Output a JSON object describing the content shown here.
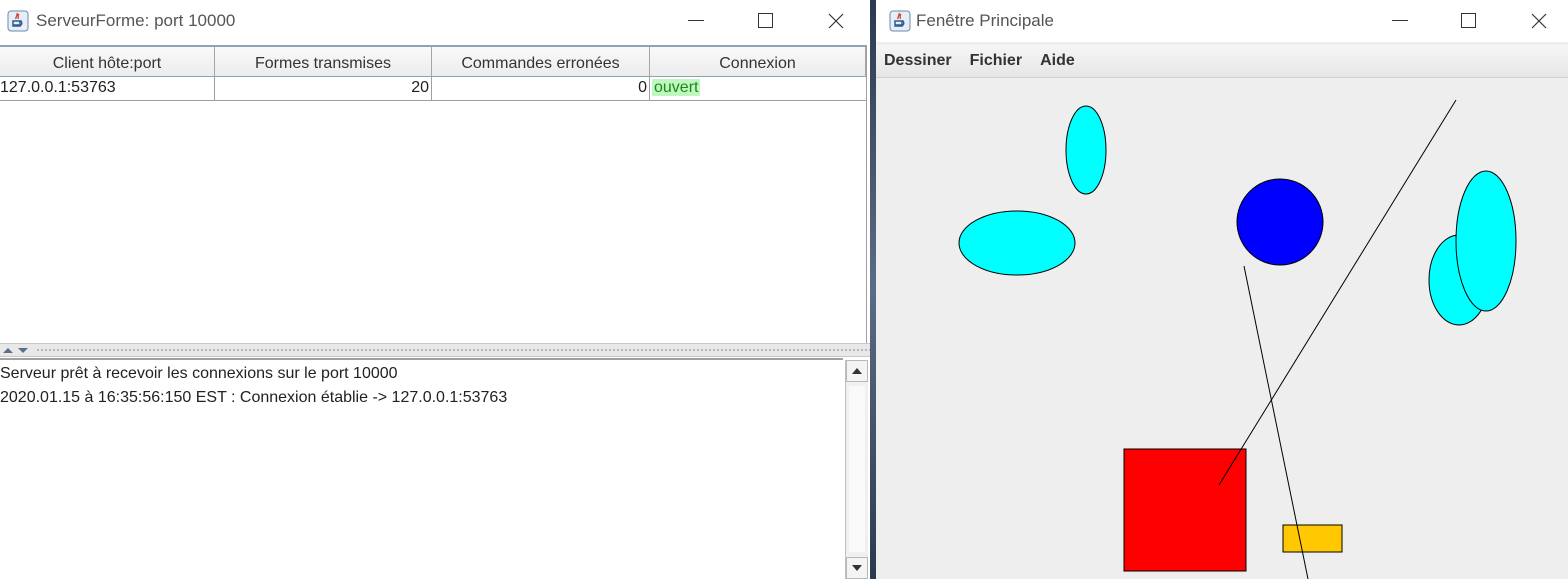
{
  "server_window": {
    "title": "ServeurForme: port 10000",
    "table": {
      "headers": [
        "Client hôte:port",
        "Formes transmises",
        "Commandes erronées",
        "Connexion"
      ],
      "rows": [
        {
          "client": "127.0.0.1:53763",
          "shapes": "20",
          "errors": "0",
          "connection": "ouvert"
        }
      ]
    },
    "log": [
      "Serveur prêt à recevoir les connexions sur le port 10000",
      "2020.01.15 à 16:35:56:150 EST : Connexion établie -> 127.0.0.1:53763"
    ]
  },
  "main_window": {
    "title": "Fenêtre Principale",
    "menu": [
      "Dessiner",
      "Fichier",
      "Aide"
    ]
  },
  "colors": {
    "cyan": "#00ffff",
    "blue": "#0000ff",
    "red": "#ff0000",
    "orange": "#ffc800",
    "status_open_bg": "#bff7bf",
    "status_open_text": "#1a8b1a"
  },
  "icons": [
    "java-app-icon",
    "minimize-icon",
    "maximize-icon",
    "close-icon",
    "scroll-up-arrow-icon",
    "scroll-down-arrow-icon",
    "collapse-up-icon",
    "collapse-down-icon"
  ]
}
